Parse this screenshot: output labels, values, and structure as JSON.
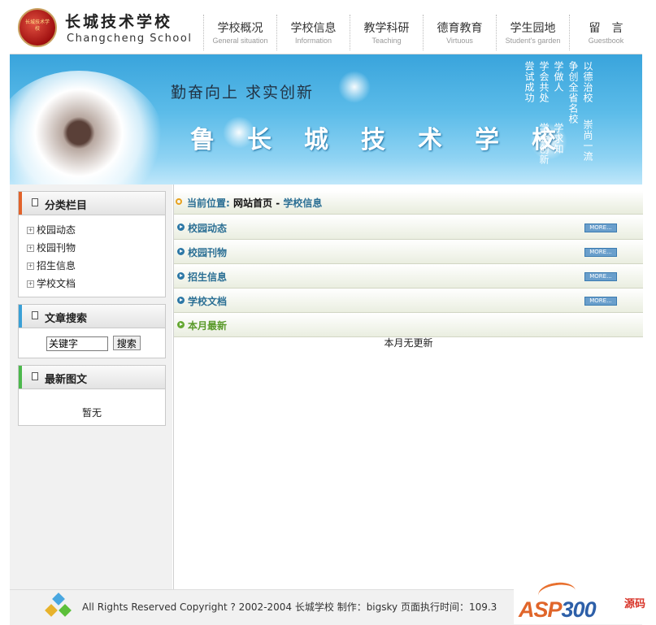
{
  "header": {
    "seal_text": "长城技术学校",
    "school_name_cn": "长城技术学校",
    "school_name_en": "Changcheng School",
    "nav": [
      {
        "cn": "学校概况",
        "en": "General situation"
      },
      {
        "cn": "学校信息",
        "en": "Information"
      },
      {
        "cn": "教学科研",
        "en": "Teaching"
      },
      {
        "cn": "德育教育",
        "en": "Virtuous"
      },
      {
        "cn": "学生园地",
        "en": "Student's garden"
      },
      {
        "cn": "留　言",
        "en": "Guestbook"
      }
    ]
  },
  "banner": {
    "slogan": "勤奋向上  求实创新",
    "title": "鲁长城技术学校",
    "motto_columns": [
      "以德治校",
      "争创全省名校",
      "崇尚一流",
      "学做人",
      "学会共处",
      "学求知",
      "尝试成功",
      "学会创新",
      "学校"
    ]
  },
  "sidebar": {
    "categories": {
      "title": "分类栏目",
      "items": [
        "校园动态",
        "校园刊物",
        "招生信息",
        "学校文档"
      ]
    },
    "search": {
      "title": "文章搜索",
      "input_value": "关键字",
      "button_label": "搜索"
    },
    "latest_images": {
      "title": "最新图文",
      "empty_text": "暂无"
    }
  },
  "main": {
    "breadcrumb": {
      "label": "当前位置:",
      "home": "网站首页",
      "separator": "-",
      "current": "学校信息"
    },
    "sections": [
      {
        "label": "校园动态",
        "more": "MORE..."
      },
      {
        "label": "校园刊物",
        "more": "MORE..."
      },
      {
        "label": "招生信息",
        "more": "MORE..."
      },
      {
        "label": "学校文档",
        "more": "MORE..."
      }
    ],
    "month_latest": {
      "label": "本月最新",
      "empty_text": "本月无更新"
    }
  },
  "footer": {
    "text": "All Rights Reserved Copyright ? 2002-2004 长城学校 制作：bigsky 页面执行时间：109.3"
  },
  "watermark": {
    "asp": "ASP",
    "num": "300",
    "cn": "源码"
  },
  "colors": {
    "categories_bar": "#e2622a",
    "search_bar": "#3aa0d6",
    "latest_bar": "#4cb84c",
    "link_blue": "#2b6f94",
    "green": "#5a9a2a"
  }
}
